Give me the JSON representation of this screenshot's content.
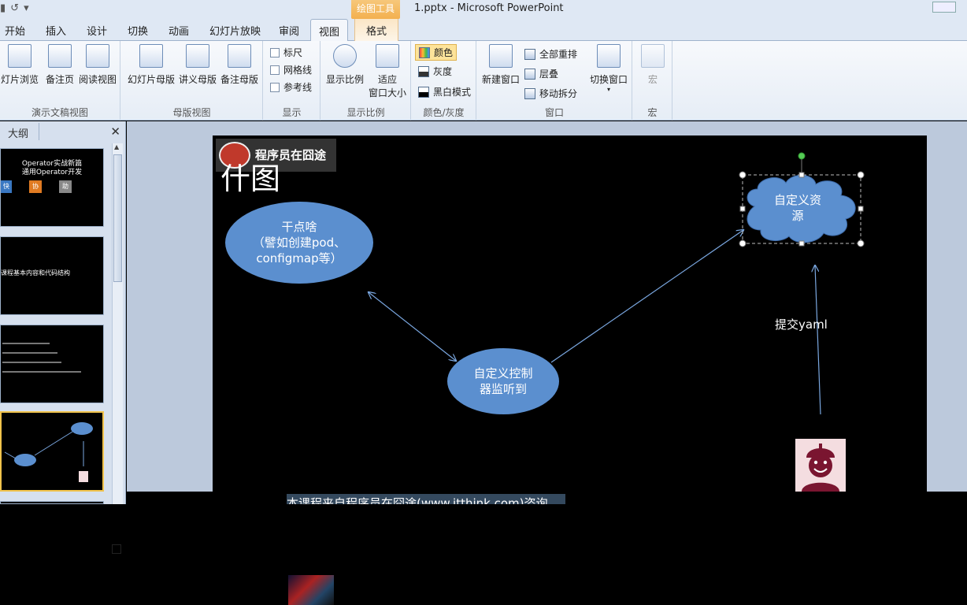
{
  "window": {
    "title": "1.pptx  -  Microsoft PowerPoint",
    "context_tab": "绘图工具"
  },
  "tabs": [
    "开始",
    "插入",
    "设计",
    "切换",
    "动画",
    "幻灯片放映",
    "审阅",
    "视图",
    "格式"
  ],
  "ribbon": {
    "presentation_views": {
      "label": "演示文稿视图",
      "buttons": [
        "灯片浏览",
        "备注页",
        "阅读视图"
      ]
    },
    "master_views": {
      "label": "母版视图",
      "buttons": [
        "幻灯片母版",
        "讲义母版",
        "备注母版"
      ]
    },
    "show": {
      "label": "显示",
      "items": [
        "标尺",
        "网格线",
        "参考线"
      ]
    },
    "zoom": {
      "label": "显示比例",
      "zoom_button": "显示比例",
      "fit_button_line1": "适应",
      "fit_button_line2": "窗口大小"
    },
    "color": {
      "label": "颜色/灰度",
      "items": [
        "颜色",
        "灰度",
        "黑白模式"
      ]
    },
    "window": {
      "label": "窗口",
      "new_window": "新建窗口",
      "arrange_all": "全部重排",
      "cascade": "层叠",
      "move_split": "移动拆分",
      "switch_window": "切换窗口"
    },
    "macro": {
      "label": "宏",
      "button": "宏"
    }
  },
  "left_panel": {
    "tab": "大纲",
    "thumb1": {
      "line1": "Operator实战新篇",
      "line2": "通用Operator开发",
      "icons": [
        "快",
        "协",
        "助"
      ]
    },
    "thumb2": {
      "line1": "课程基本内容和代码结构"
    }
  },
  "slide": {
    "logo_text": "程序员在囧途",
    "title": "什图",
    "ellipse1": "干点啥\n（譬如创建pod、\nconfigmap等）",
    "ellipse2": "自定义控制\n器监听到",
    "cloud": "自定义资\n源",
    "yaml_label": "提交yaml",
    "footer": "本课程来自程序员在囧途(www.jtthink.com)咨询"
  }
}
